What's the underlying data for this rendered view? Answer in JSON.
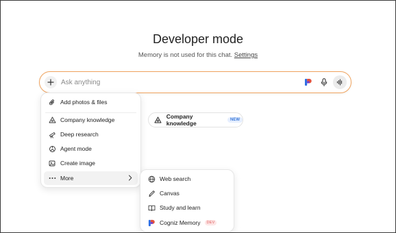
{
  "header": {
    "title": "Developer mode",
    "subtitle_text": "Memory is not used for this chat.",
    "settings_link": "Settings"
  },
  "composer": {
    "placeholder": "Ask anything",
    "icons": [
      "plus-icon",
      "cogniz-logo-icon",
      "microphone-icon",
      "voice-waveform-icon"
    ]
  },
  "menu": {
    "items": [
      {
        "label": "Add photos & files",
        "icon": "paperclip-icon"
      },
      {
        "label": "Company knowledge",
        "icon": "company-knowledge-icon"
      },
      {
        "label": "Deep research",
        "icon": "telescope-icon"
      },
      {
        "label": "Agent mode",
        "icon": "agent-icon"
      },
      {
        "label": "Create image",
        "icon": "image-icon"
      },
      {
        "label": "More",
        "icon": "ellipsis-icon",
        "highlighted": true
      }
    ]
  },
  "submenu": {
    "items": [
      {
        "label": "Web search",
        "icon": "globe-icon"
      },
      {
        "label": "Canvas",
        "icon": "canvas-pen-icon"
      },
      {
        "label": "Study and learn",
        "icon": "book-icon"
      },
      {
        "label": "Cogniz Memory",
        "icon": "cogniz-logo-icon",
        "badge": "DEV"
      }
    ]
  },
  "chip": {
    "label": "Company knowledge",
    "badge": "NEW",
    "icon": "company-knowledge-icon"
  },
  "colors": {
    "composer_border": "#f0a35e",
    "new_badge": "#3a78d8",
    "dev_badge": "#e06060"
  }
}
